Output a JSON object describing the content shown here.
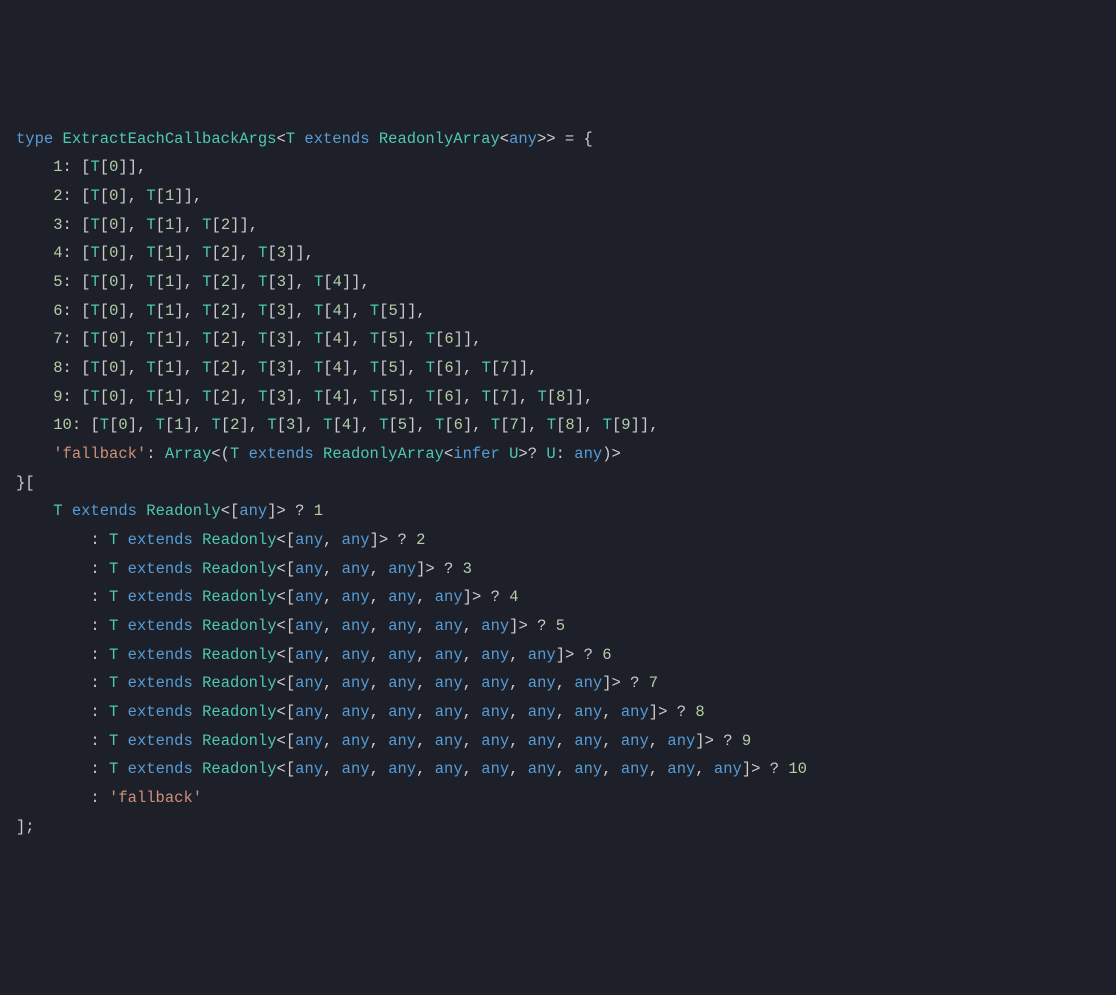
{
  "code": {
    "typeName": "ExtractEachCallbackArgs",
    "typeParam": "T",
    "extendsType": "ReadonlyArray",
    "anyKeyword": "any",
    "inferKeyword": "infer",
    "typeKeyword": "type",
    "extendsKeyword": "extends",
    "readonlyType": "Readonly",
    "arrayType": "Array",
    "fallbackKey": "'fallback'",
    "fallbackLiteral": "'fallback'",
    "inferParam": "U",
    "tupleMap": {
      "1": [
        "T[0]"
      ],
      "2": [
        "T[0]",
        "T[1]"
      ],
      "3": [
        "T[0]",
        "T[1]",
        "T[2]"
      ],
      "4": [
        "T[0]",
        "T[1]",
        "T[2]",
        "T[3]"
      ],
      "5": [
        "T[0]",
        "T[1]",
        "T[2]",
        "T[3]",
        "T[4]"
      ],
      "6": [
        "T[0]",
        "T[1]",
        "T[2]",
        "T[3]",
        "T[4]",
        "T[5]"
      ],
      "7": [
        "T[0]",
        "T[1]",
        "T[2]",
        "T[3]",
        "T[4]",
        "T[5]",
        "T[6]"
      ],
      "8": [
        "T[0]",
        "T[1]",
        "T[2]",
        "T[3]",
        "T[4]",
        "T[5]",
        "T[6]",
        "T[7]"
      ],
      "9": [
        "T[0]",
        "T[1]",
        "T[2]",
        "T[3]",
        "T[4]",
        "T[5]",
        "T[6]",
        "T[7]",
        "T[8]"
      ],
      "10": [
        "T[0]",
        "T[1]",
        "T[2]",
        "T[3]",
        "T[4]",
        "T[5]",
        "T[6]",
        "T[7]",
        "T[8]",
        "T[9]"
      ]
    },
    "conditions": [
      {
        "count": 1,
        "result": "1"
      },
      {
        "count": 2,
        "result": "2"
      },
      {
        "count": 3,
        "result": "3"
      },
      {
        "count": 4,
        "result": "4"
      },
      {
        "count": 5,
        "result": "5"
      },
      {
        "count": 6,
        "result": "6"
      },
      {
        "count": 7,
        "result": "7"
      },
      {
        "count": 8,
        "result": "8"
      },
      {
        "count": 9,
        "result": "9"
      },
      {
        "count": 10,
        "result": "10"
      }
    ]
  }
}
